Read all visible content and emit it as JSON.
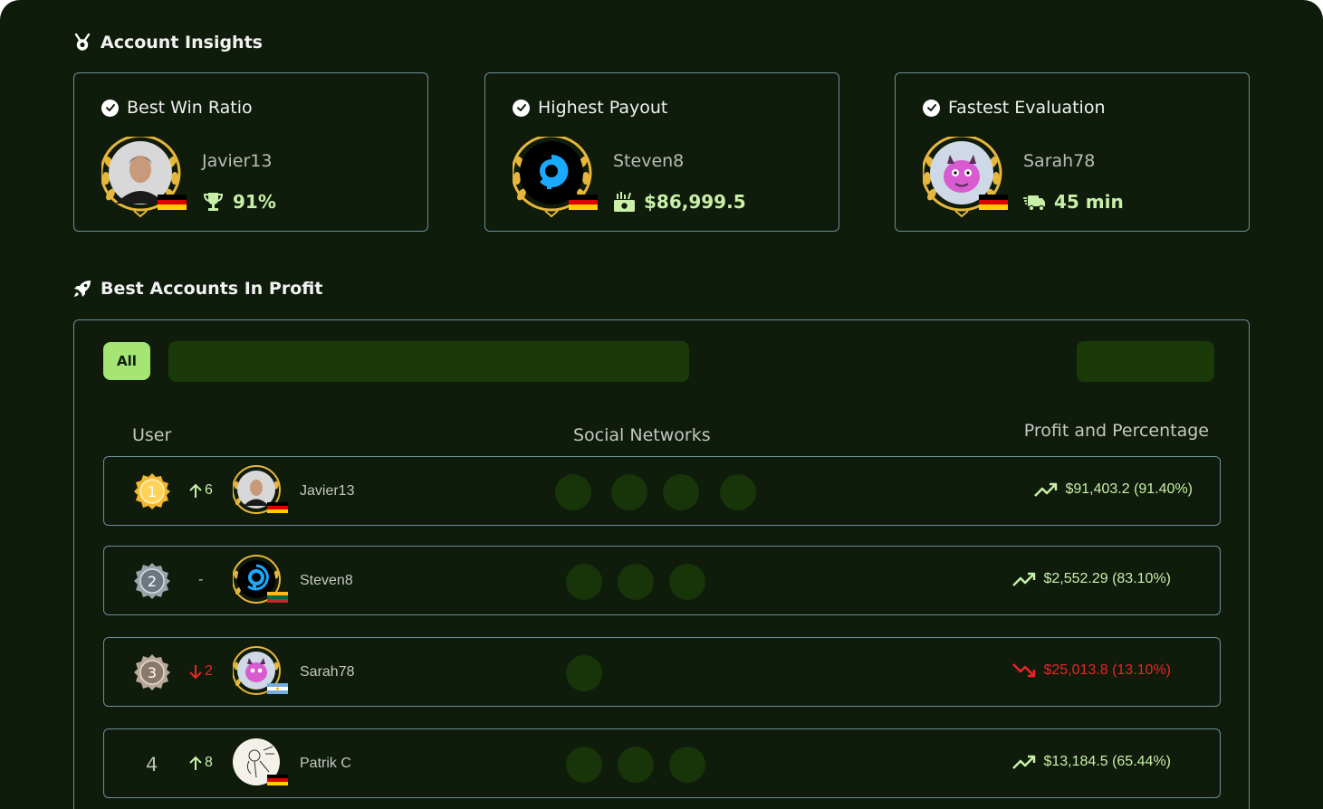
{
  "insights": {
    "title": "Account Insights",
    "cards": [
      {
        "title": "Best Win Ratio",
        "user": "Javier13",
        "stat": "91%",
        "stat_icon": "trophy-icon",
        "avatar": "man-photo",
        "flag": "Germany"
      },
      {
        "title": "Highest Payout",
        "user": "Steven8",
        "stat": "$86,999.5",
        "stat_icon": "money-icon",
        "avatar": "blue-logo",
        "flag": "Germany"
      },
      {
        "title": "Fastest Evaluation",
        "user": "Sarah78",
        "stat": "45 min",
        "stat_icon": "truck-fast-icon",
        "avatar": "pink-monster",
        "flag": "Germany"
      }
    ]
  },
  "leaderboard": {
    "title": "Best Accounts In Profit",
    "filter_all_label": "All",
    "columns": {
      "user": "User",
      "social": "Social Networks",
      "profit": "Profit and Percentage"
    },
    "rows": [
      {
        "rank": "1",
        "medal": "gold",
        "movement": "6",
        "direction": "up",
        "name": "Javier13",
        "flag": "Germany",
        "social_count": 4,
        "profit": "$91,403.2 (91.40%)",
        "trend": "up"
      },
      {
        "rank": "2",
        "medal": "silver",
        "movement": "-",
        "direction": "same",
        "name": "Steven8",
        "flag": "Lithuania",
        "social_count": 3,
        "profit": "$2,552.29 (83.10%)",
        "trend": "up"
      },
      {
        "rank": "3",
        "medal": "bronze",
        "movement": "2",
        "direction": "down",
        "name": "Sarah78",
        "flag": "Argentina",
        "social_count": 1,
        "profit": "$25,013.8 (13.10%)",
        "trend": "down"
      },
      {
        "rank": "4",
        "medal": "none",
        "movement": "8",
        "direction": "up",
        "name": "Patrik C",
        "flag": "Germany",
        "social_count": 3,
        "profit": "$13,184.5 (65.44%)",
        "trend": "up"
      }
    ]
  },
  "colors": {
    "background": "#0f1b0b",
    "accent_green": "#a4e574",
    "text_green": "#c9f0a8",
    "negative_red": "#e8262a",
    "border": "#6b8f9a",
    "chip_dark": "#183509"
  }
}
